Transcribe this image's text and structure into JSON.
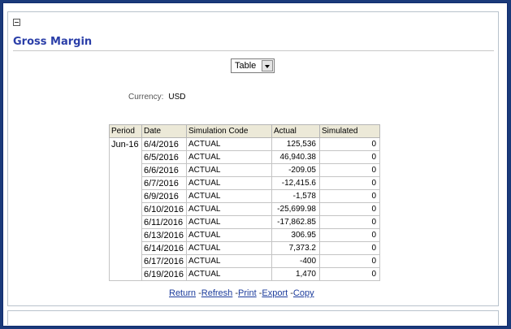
{
  "section": {
    "title": "Gross Margin"
  },
  "view_selector": {
    "selected": "Table"
  },
  "currency": {
    "label": "Currency:",
    "value": "USD"
  },
  "table": {
    "headers": [
      "Period",
      "Date",
      "Simulation Code",
      "Actual",
      "Simulated"
    ],
    "period": "Jun-16",
    "rows": [
      {
        "date": "6/4/2016",
        "code": "ACTUAL",
        "actual": "125,536",
        "simulated": "0"
      },
      {
        "date": "6/5/2016",
        "code": "ACTUAL",
        "actual": "46,940.38",
        "simulated": "0"
      },
      {
        "date": "6/6/2016",
        "code": "ACTUAL",
        "actual": "-209.05",
        "simulated": "0"
      },
      {
        "date": "6/7/2016",
        "code": "ACTUAL",
        "actual": "-12,415.6",
        "simulated": "0"
      },
      {
        "date": "6/9/2016",
        "code": "ACTUAL",
        "actual": "-1,578",
        "simulated": "0"
      },
      {
        "date": "6/10/2016",
        "code": "ACTUAL",
        "actual": "-25,699.98",
        "simulated": "0"
      },
      {
        "date": "6/11/2016",
        "code": "ACTUAL",
        "actual": "-17,862.85",
        "simulated": "0"
      },
      {
        "date": "6/13/2016",
        "code": "ACTUAL",
        "actual": "306.95",
        "simulated": "0"
      },
      {
        "date": "6/14/2016",
        "code": "ACTUAL",
        "actual": "7,373.2",
        "simulated": "0"
      },
      {
        "date": "6/17/2016",
        "code": "ACTUAL",
        "actual": "-400",
        "simulated": "0"
      },
      {
        "date": "6/19/2016",
        "code": "ACTUAL",
        "actual": "1,470",
        "simulated": "0"
      }
    ]
  },
  "links": {
    "return": "Return",
    "refresh": "Refresh",
    "print": "Print",
    "export": "Export",
    "copy": "Copy",
    "separator": "-"
  }
}
